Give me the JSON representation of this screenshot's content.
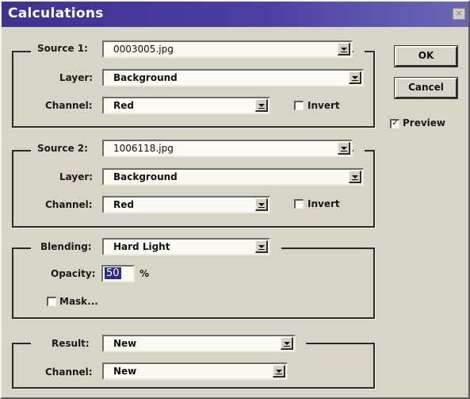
{
  "window": {
    "title": "Calculations",
    "close_glyph": "×"
  },
  "source1": {
    "label": "Source 1:",
    "file": "0003005.jpg",
    "layer_label": "Layer:",
    "layer": "Background",
    "channel_label": "Channel:",
    "channel": "Red",
    "invert_label": "Invert",
    "invert_checked": false
  },
  "source2": {
    "label": "Source 2:",
    "file": "1006118.jpg",
    "layer_label": "Layer:",
    "layer": "Background",
    "channel_label": "Channel:",
    "channel": "Red",
    "invert_label": "Invert",
    "invert_checked": false
  },
  "blending": {
    "label": "Blending:",
    "mode": "Hard Light",
    "opacity_label": "Opacity:",
    "opacity": "50",
    "opacity_unit": "%",
    "mask_label": "Mask...",
    "mask_checked": false
  },
  "result": {
    "label": "Result:",
    "value": "New",
    "channel_label": "Channel:",
    "channel": "New"
  },
  "buttons": {
    "ok": "OK",
    "cancel": "Cancel"
  },
  "preview": {
    "label": "Preview",
    "checked": true,
    "check_glyph": "✓"
  },
  "colors": {
    "titlebar": "#3f318f",
    "face": "#d9d4c8",
    "selection": "#2a2d8c"
  }
}
